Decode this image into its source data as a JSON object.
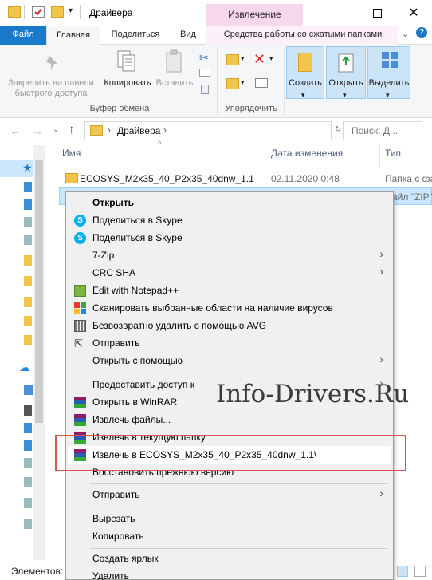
{
  "window": {
    "title": "Драйвера",
    "context_tab_title": "Извлечение"
  },
  "ribbon_tabs": [
    "Файл",
    "Главная",
    "Поделиться",
    "Вид",
    "Средства работы со сжатыми папками"
  ],
  "ribbon": {
    "pin_label": "Закрепить на панели быстрого доступа",
    "pin_line1": "Закрепить на панели",
    "pin_line2": "быстрого доступа",
    "copy_label": "Копировать",
    "paste_label": "Вставить",
    "clipboard_group": "Буфер обмена",
    "organize_group": "Упорядочить",
    "create_label": "Создать",
    "open_label": "Открыть",
    "select_label": "Выделить"
  },
  "address": {
    "path": "Драйвера",
    "search_placeholder": "Поиск: Д..."
  },
  "columns": {
    "name": "Имя",
    "date": "Дата изменения",
    "type": "Тип"
  },
  "files": [
    {
      "name": "ECOSYS_M2x35_40_P2x35_40dnw_1.1",
      "date": "02.11.2020 0:48",
      "type": "Папка с фа"
    },
    {
      "name": "",
      "date": "",
      "type": "айл \"ZIP\""
    }
  ],
  "context_menu": {
    "open": "Открыть",
    "skype1": "Поделиться в Skype",
    "skype2": "Поделиться в Skype",
    "zip7": "7-Zip",
    "crc": "CRC SHA",
    "notepad": "Edit with Notepad++",
    "avg_scan": "Сканировать выбранные области на наличие вирусов",
    "avg_delete": "Безвозвратно удалить с помощью AVG",
    "send": "Отправить",
    "open_with": "Открыть с помощью",
    "grant_access": "Предоставить доступ к",
    "open_winrar": "Открыть в WinRAR",
    "extract_files": "Извлечь файлы...",
    "extract_here": "Извлечь в текущую папку",
    "extract_to": "Извлечь в ECOSYS_M2x35_40_P2x35_40dnw_1.1\\",
    "restore": "Восстановить прежнюю версию",
    "send_to": "Отправить",
    "cut": "Вырезать",
    "copy": "Копировать",
    "create_shortcut": "Создать ярлык",
    "delete": "Удалить"
  },
  "status": {
    "items_label": "Элементов:"
  },
  "watermark": "Info-Drivers.Ru",
  "colors": {
    "accent": "#1979ca",
    "context_tab": "#f7d7eb",
    "selection": "#cce8ff",
    "highlight_box": "#d9534f"
  }
}
